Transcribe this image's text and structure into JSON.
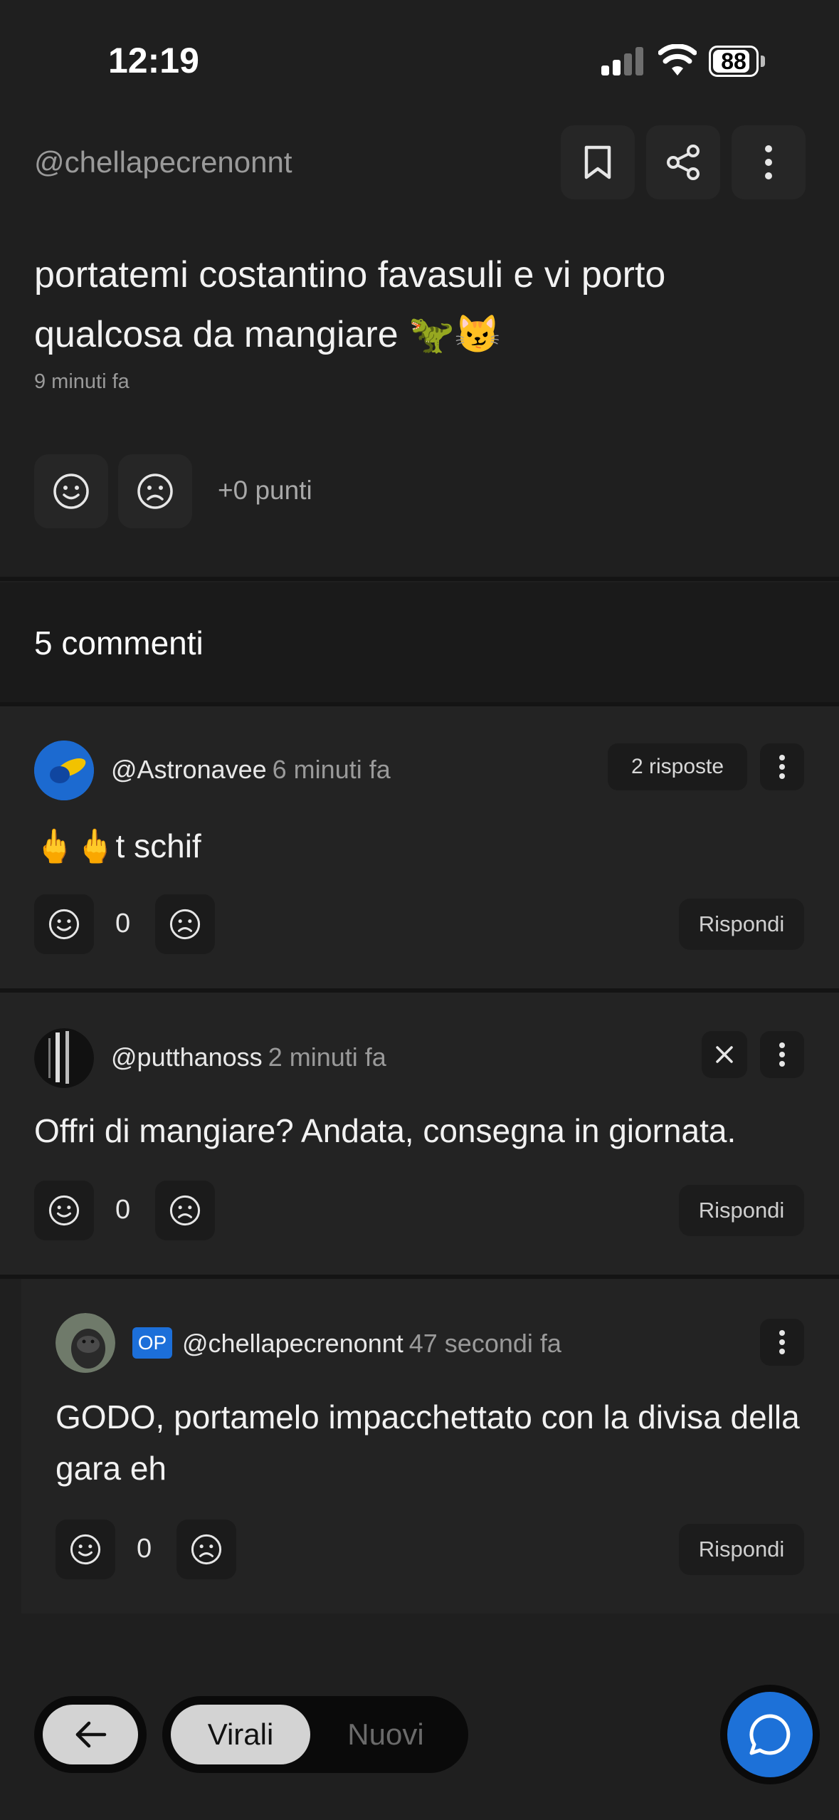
{
  "status_bar": {
    "time": "12:19",
    "battery": "88",
    "battery_level": 0.88
  },
  "post": {
    "author": "@chellapecrenonnt",
    "text": "portatemi costantino favasuli e vi porto qualcosa da mangiare 🦖😼",
    "time": "9 minuti fa",
    "points": "+0 punti"
  },
  "icons": {
    "bookmark": "bookmark-icon",
    "share": "share-icon",
    "more": "more-vertical-icon",
    "upvote": "smile-face-icon",
    "downvote": "sad-face-icon",
    "close": "close-icon",
    "back": "arrow-left-icon",
    "chat": "chat-bubble-icon"
  },
  "comments_header": "5 commenti",
  "comments": [
    {
      "user": "@Astronavee",
      "time": "6 minuti fa",
      "replies": "2 risposte",
      "text": "🖕🖕t schif",
      "score": "0",
      "reply_label": "Rispondi"
    },
    {
      "user": "@putthanoss",
      "time": "2 minuti fa",
      "text": "Offri di mangiare? Andata, consegna in giornata.",
      "score": "0",
      "reply_label": "Rispondi"
    },
    {
      "op_badge": "OP",
      "user": "@chellapecrenonnt",
      "time": "47 secondi fa",
      "text": "GODO, portamelo impacchettato con la divisa della gara eh",
      "score": "0",
      "reply_label": "Rispondi"
    }
  ],
  "bottom_bar": {
    "tab_active": "Virali",
    "tab_inactive": "Nuovi"
  },
  "colors": {
    "accent": "#1d71d8",
    "background": "#1f1f1f",
    "card": "#232323"
  }
}
